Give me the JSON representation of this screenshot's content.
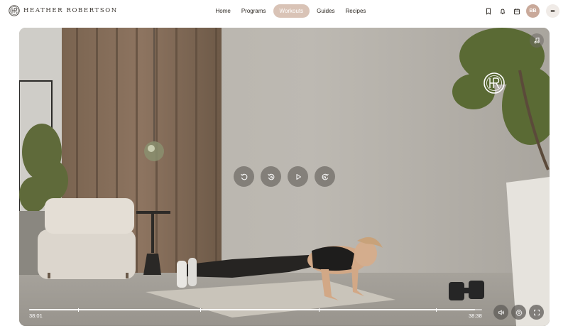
{
  "brand": {
    "name": "HEATHER ROBERTSON",
    "icon": "hr-monogram-icon"
  },
  "nav": {
    "items": [
      {
        "label": "Home",
        "active": false
      },
      {
        "label": "Programs",
        "active": false
      },
      {
        "label": "Workouts",
        "active": true
      },
      {
        "label": "Guides",
        "active": false
      },
      {
        "label": "Recipes",
        "active": false
      }
    ]
  },
  "header_icons": [
    "bookmark-icon",
    "bell-icon",
    "calendar-icon"
  ],
  "avatar": {
    "initials": "BB"
  },
  "player": {
    "current_time": "38:01",
    "duration": "38:38",
    "progress": 0.984,
    "chapter_marks": [
      0.108,
      0.378,
      0.64,
      0.898
    ],
    "center_controls": [
      "replay-icon",
      "rewind-15-icon",
      "play-icon",
      "forward-15-icon"
    ],
    "bottom_controls": [
      "volume-icon",
      "settings-icon",
      "fullscreen-icon"
    ],
    "top_right_control": "music-note-icon"
  },
  "colors": {
    "accent": "#d9c3b6",
    "avatar": "#c9a99a"
  }
}
